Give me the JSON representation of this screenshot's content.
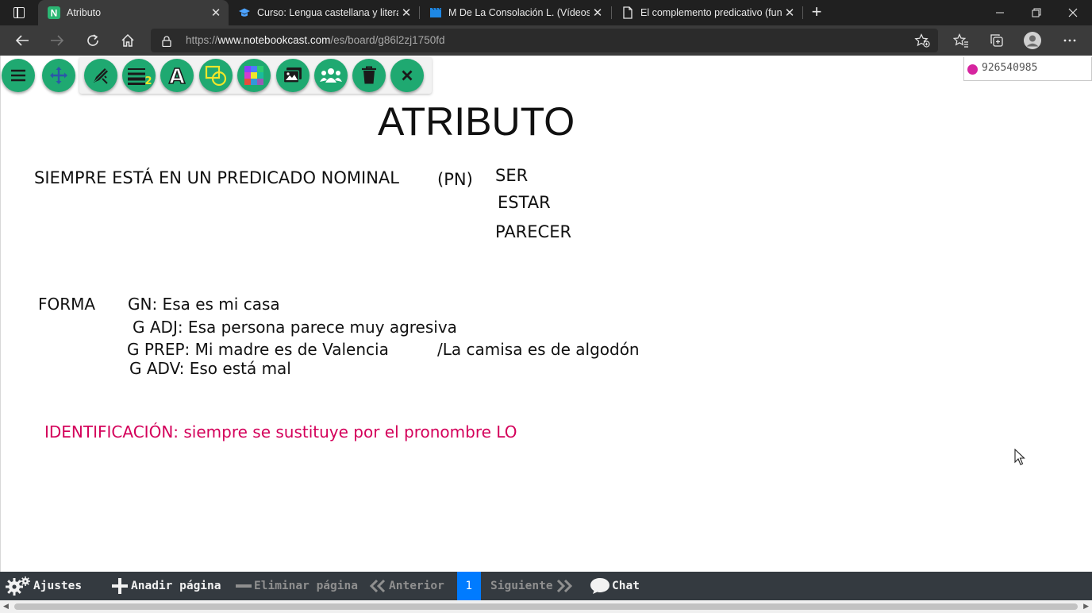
{
  "browser": {
    "tabs": [
      {
        "label": "Atributo",
        "icon": "notebookcast-favicon",
        "active": true
      },
      {
        "label": "Curso: Lengua castellana y literat",
        "icon": "graduation-cap-favicon",
        "active": false
      },
      {
        "label": "M De La Consolación L. (Vídeos)",
        "icon": "video-clapper-favicon",
        "active": false
      },
      {
        "label": "El complemento predicativo (fun",
        "icon": "page-favicon",
        "active": false
      }
    ],
    "url_prefix": "https://",
    "url_domain": "www.notebookcast.com",
    "url_path": "/es/board/g86l2zj1750fd"
  },
  "board": {
    "user_id": "926540985",
    "user_color": "#d6249f",
    "title": "ATRIBUTO",
    "pn_line": "SIEMPRE ESTÁ EN UN PREDICADO NOMINAL",
    "pn_abbrev": "(PN)",
    "verbs": [
      "SER",
      "ESTAR",
      "PARECER"
    ],
    "forma_label": "FORMA",
    "forma_items": [
      "GN: Esa es mi casa",
      "G ADJ: Esa persona parece muy agresiva",
      "G PREP: Mi madre es de Valencia",
      "G ADV: Eso está mal"
    ],
    "forma_extra": "/La camisa es de algodón",
    "identification": "IDENTIFICACIÓN: siempre se sustituye por el pronombre LO",
    "identification_color": "#d4005a"
  },
  "toolbar": {
    "accent": "#1fa971",
    "tools": [
      "menu-icon",
      "move-icon",
      "pen-ruler-icon",
      "line-width-icon",
      "text-icon",
      "shapes-icon",
      "color-palette-icon",
      "image-icon",
      "users-icon",
      "trash-icon",
      "close-icon"
    ],
    "line_width_value": "2"
  },
  "bottombar": {
    "settings": "Ajustes",
    "add_page": "Anadir página",
    "delete_page": "Eliminar página",
    "previous": "Anterior",
    "page_number": "1",
    "next": "Siguiente",
    "chat": "Chat"
  }
}
